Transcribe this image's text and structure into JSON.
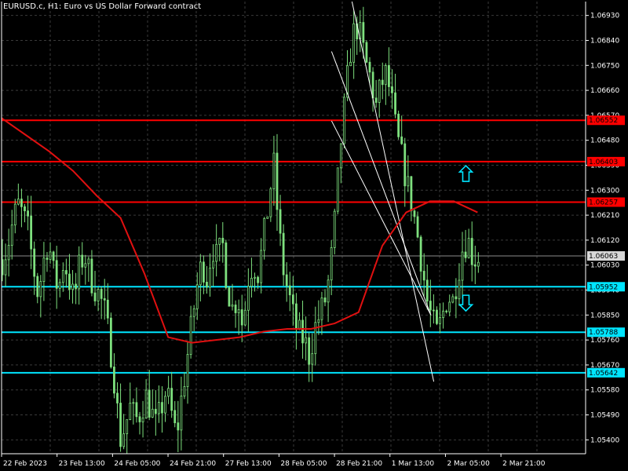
{
  "header": {
    "symbol_title": "EURUSD.c, H1:  Euro vs US Dollar Forward contract"
  },
  "colors": {
    "background": "#000000",
    "grid": "#3a3a3a",
    "axis": "#ffffff",
    "text": "#ffffff",
    "candle": "#7ee07e",
    "ma": "#e01010",
    "resistance": "#ff0000",
    "support": "#00e5ff",
    "channel": "#ffffff",
    "current_price_line": "#8c8c8c",
    "arrow": "#00e5ff"
  },
  "chart_data": {
    "type": "candlestick",
    "timeframe": "H1",
    "ylim": [
      1.0535,
      1.0698
    ],
    "y_ticks": [
      "1.06930",
      "1.06840",
      "1.06750",
      "1.06660",
      "1.06570",
      "1.06480",
      "1.06390",
      "1.06300",
      "1.06210",
      "1.06120",
      "1.06030",
      "1.05940",
      "1.05850",
      "1.05760",
      "1.05670",
      "1.05580",
      "1.05490",
      "1.05400"
    ],
    "x_labels": [
      "22 Feb 2023",
      "23 Feb 13:00",
      "24 Feb 05:00",
      "24 Feb 21:00",
      "27 Feb 13:00",
      "28 Feb 05:00",
      "28 Feb 21:00",
      "1 Mar 13:00",
      "2 Mar 05:00",
      "2 Mar 21:00"
    ],
    "current_price": "1.06063",
    "resistance_levels": [
      {
        "label": "1.06552",
        "value": 1.06552
      },
      {
        "label": "1.06403",
        "value": 1.06403
      },
      {
        "label": "1.06257",
        "value": 1.06257
      }
    ],
    "support_levels": [
      {
        "label": "1.05952",
        "value": 1.05952
      },
      {
        "label": "1.05788",
        "value": 1.05788
      },
      {
        "label": "1.05642",
        "value": 1.05642
      }
    ],
    "price_path": [
      1.0605,
      1.061,
      1.0618,
      1.0625,
      1.0621,
      1.0616,
      1.0603,
      1.0592,
      1.0604,
      1.0612,
      1.06,
      1.0594,
      1.0605,
      1.0598,
      1.059,
      1.0602,
      1.0607,
      1.06,
      1.0595,
      1.0592,
      1.0586,
      1.0575,
      1.056,
      1.054,
      1.0545,
      1.0552,
      1.0547,
      1.055,
      1.0556,
      1.0551,
      1.0545,
      1.0551,
      1.0558,
      1.055,
      1.0541,
      1.0555,
      1.0568,
      1.0582,
      1.0595,
      1.0604,
      1.0598,
      1.061,
      1.0605,
      1.0611,
      1.0595,
      1.0587,
      1.0592,
      1.058,
      1.0598,
      1.0604,
      1.06,
      1.0612,
      1.0625,
      1.064,
      1.0616,
      1.06,
      1.0592,
      1.0583,
      1.0578,
      1.0576,
      1.057,
      1.058,
      1.0585,
      1.059,
      1.06,
      1.062,
      1.0645,
      1.0663,
      1.068,
      1.069,
      1.0685,
      1.0676,
      1.067,
      1.066,
      1.0668,
      1.0672,
      1.0663,
      1.065,
      1.0642,
      1.0633,
      1.0625,
      1.0615,
      1.0603,
      1.059,
      1.0583,
      1.0578,
      1.0585,
      1.0592,
      1.059,
      1.06,
      1.061,
      1.0612,
      1.0605,
      1.0606
    ],
    "ma_path": [
      1.0656,
      1.065,
      1.0644,
      1.0637,
      1.0628,
      1.062,
      1.06,
      1.0577,
      1.0575,
      1.0576,
      1.0577,
      1.0579,
      1.058,
      1.058,
      1.0582,
      1.0586,
      1.061,
      1.0622,
      1.0626,
      1.0626,
      1.0622
    ],
    "channel_lines": [
      {
        "from": [
          0.6,
          1.0698
        ],
        "to": [
          0.74,
          1.0561
        ]
      },
      {
        "from": [
          0.565,
          1.068
        ],
        "to": [
          0.735,
          1.0585
        ]
      },
      {
        "from": [
          0.565,
          1.0655
        ],
        "to": [
          0.735,
          1.0585
        ]
      }
    ],
    "signals": [
      {
        "name": "up-arrow",
        "direction": "up",
        "x": 0.795,
        "y": 1.0636
      },
      {
        "name": "down-arrow",
        "direction": "down",
        "x": 0.795,
        "y": 1.05893
      }
    ]
  }
}
